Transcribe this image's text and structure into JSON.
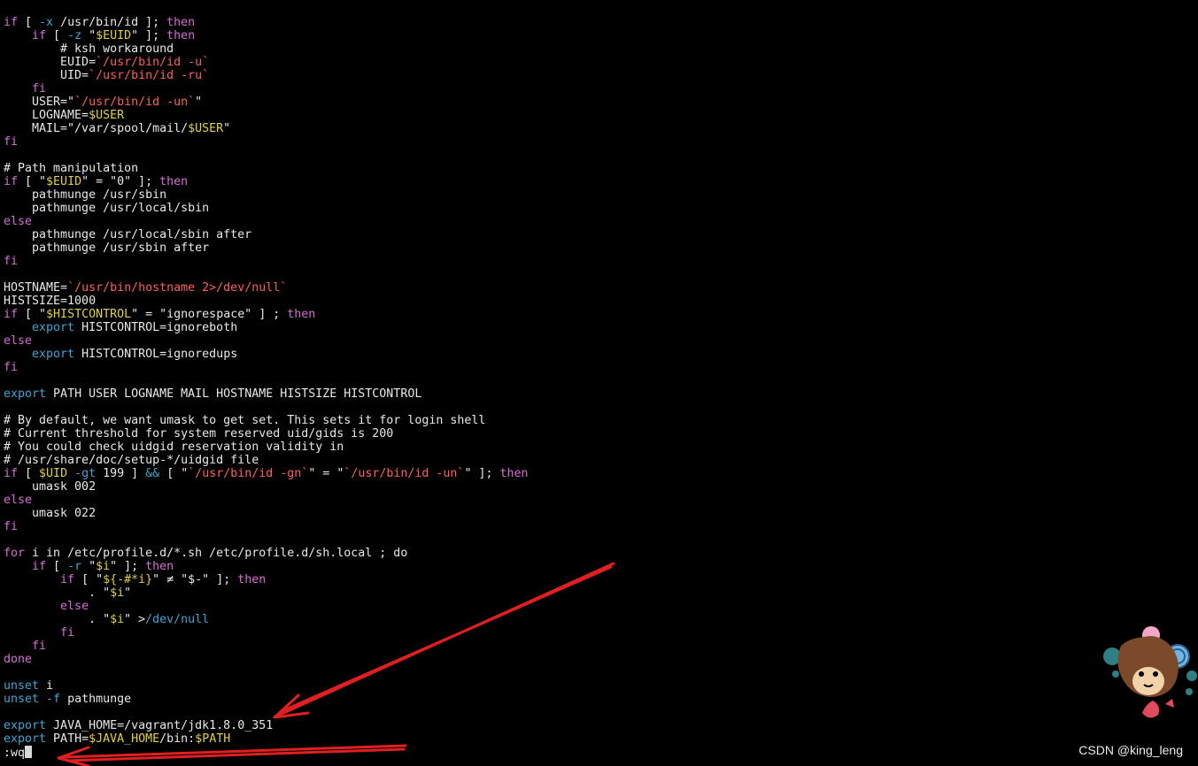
{
  "editor": {
    "command_line": ":wq",
    "lines": [
      [
        [
          "k",
          "if"
        ],
        [
          "d",
          " [ "
        ],
        [
          "o",
          "-x"
        ],
        [
          "d",
          " /usr/bin/id ]; "
        ],
        [
          "k",
          "then"
        ]
      ],
      [
        [
          "d",
          "    "
        ],
        [
          "k",
          "if"
        ],
        [
          "d",
          " [ "
        ],
        [
          "o",
          "-z"
        ],
        [
          "d",
          " \""
        ],
        [
          "v",
          "$EUID"
        ],
        [
          "d",
          "\" ]; "
        ],
        [
          "k",
          "then"
        ]
      ],
      [
        [
          "c",
          "        # ksh workaround"
        ]
      ],
      [
        [
          "d",
          "        EUID="
        ],
        [
          "s",
          "`/usr/bin/id -u`"
        ]
      ],
      [
        [
          "d",
          "        UID="
        ],
        [
          "s",
          "`/usr/bin/id -ru`"
        ]
      ],
      [
        [
          "d",
          "    "
        ],
        [
          "k",
          "fi"
        ]
      ],
      [
        [
          "d",
          "    USER=\""
        ],
        [
          "s",
          "`/usr/bin/id -un`"
        ],
        [
          "d",
          "\""
        ]
      ],
      [
        [
          "d",
          "    LOGNAME="
        ],
        [
          "v",
          "$USER"
        ]
      ],
      [
        [
          "d",
          "    MAIL=\"/var/spool/mail/"
        ],
        [
          "v",
          "$USER"
        ],
        [
          "d",
          "\""
        ]
      ],
      [
        [
          "k",
          "fi"
        ]
      ],
      [],
      [
        [
          "c",
          "# Path manipulation"
        ]
      ],
      [
        [
          "k",
          "if"
        ],
        [
          "d",
          " [ \""
        ],
        [
          "v",
          "$EUID"
        ],
        [
          "d",
          "\" = \"0\" ]; "
        ],
        [
          "k",
          "then"
        ]
      ],
      [
        [
          "d",
          "    pathmunge /usr/sbin"
        ]
      ],
      [
        [
          "d",
          "    pathmunge /usr/local/sbin"
        ]
      ],
      [
        [
          "k",
          "else"
        ]
      ],
      [
        [
          "d",
          "    pathmunge /usr/local/sbin after"
        ]
      ],
      [
        [
          "d",
          "    pathmunge /usr/sbin after"
        ]
      ],
      [
        [
          "k",
          "fi"
        ]
      ],
      [],
      [
        [
          "d",
          "HOSTNAME="
        ],
        [
          "s",
          "`/usr/bin/hostname 2>/dev/null`"
        ]
      ],
      [
        [
          "d",
          "HISTSIZE=1000"
        ]
      ],
      [
        [
          "k",
          "if"
        ],
        [
          "d",
          " [ \""
        ],
        [
          "v",
          "$HISTCONTROL"
        ],
        [
          "d",
          "\" = \"ignorespace\" ] ; "
        ],
        [
          "k",
          "then"
        ]
      ],
      [
        [
          "d",
          "    "
        ],
        [
          "kb",
          "export"
        ],
        [
          "d",
          " HISTCONTROL=ignoreboth"
        ]
      ],
      [
        [
          "k",
          "else"
        ]
      ],
      [
        [
          "d",
          "    "
        ],
        [
          "kb",
          "export"
        ],
        [
          "d",
          " HISTCONTROL=ignoredups"
        ]
      ],
      [
        [
          "k",
          "fi"
        ]
      ],
      [],
      [
        [
          "kb",
          "export"
        ],
        [
          "d",
          " PATH USER LOGNAME MAIL HOSTNAME HISTSIZE HISTCONTROL"
        ]
      ],
      [],
      [
        [
          "c",
          "# By default, we want umask to get set. This sets it for login shell"
        ]
      ],
      [
        [
          "c",
          "# Current threshold for system reserved uid/gids is 200"
        ]
      ],
      [
        [
          "c",
          "# You could check uidgid reservation validity in"
        ]
      ],
      [
        [
          "c",
          "# /usr/share/doc/setup-*/uidgid file"
        ]
      ],
      [
        [
          "k",
          "if"
        ],
        [
          "d",
          " [ "
        ],
        [
          "v",
          "$UID"
        ],
        [
          "d",
          " "
        ],
        [
          "o",
          "-gt"
        ],
        [
          "d",
          " 199 ] "
        ],
        [
          "o",
          "&&"
        ],
        [
          "d",
          " [ \""
        ],
        [
          "s",
          "`/usr/bin/id -gn`"
        ],
        [
          "d",
          "\" = \""
        ],
        [
          "s",
          "`/usr/bin/id -un`"
        ],
        [
          "d",
          "\" ]; "
        ],
        [
          "k",
          "then"
        ]
      ],
      [
        [
          "d",
          "    umask 002"
        ]
      ],
      [
        [
          "k",
          "else"
        ]
      ],
      [
        [
          "d",
          "    umask 022"
        ]
      ],
      [
        [
          "k",
          "fi"
        ]
      ],
      [],
      [
        [
          "k",
          "for"
        ],
        [
          "d",
          " i in /etc/profile.d/*.sh /etc/profile.d/sh.local ; do"
        ]
      ],
      [
        [
          "d",
          "    "
        ],
        [
          "k",
          "if"
        ],
        [
          "d",
          " [ "
        ],
        [
          "o",
          "-r"
        ],
        [
          "d",
          " \""
        ],
        [
          "v",
          "$i"
        ],
        [
          "d",
          "\" ]; "
        ],
        [
          "k",
          "then"
        ]
      ],
      [
        [
          "d",
          "        "
        ],
        [
          "k",
          "if"
        ],
        [
          "d",
          " [ \""
        ],
        [
          "v",
          "${-#*i}"
        ],
        [
          "d",
          "\" ≠ \"$-\" ]; "
        ],
        [
          "k",
          "then"
        ]
      ],
      [
        [
          "d",
          "            . \""
        ],
        [
          "v",
          "$i"
        ],
        [
          "d",
          "\""
        ]
      ],
      [
        [
          "d",
          "        "
        ],
        [
          "k",
          "else"
        ]
      ],
      [
        [
          "d",
          "            . \""
        ],
        [
          "v",
          "$i"
        ],
        [
          "d",
          "\" >"
        ],
        [
          "p",
          "/dev/null"
        ]
      ],
      [
        [
          "d",
          "        "
        ],
        [
          "k",
          "fi"
        ]
      ],
      [
        [
          "d",
          "    "
        ],
        [
          "k",
          "fi"
        ]
      ],
      [
        [
          "k",
          "done"
        ]
      ],
      [],
      [
        [
          "kb",
          "unset"
        ],
        [
          "d",
          " i"
        ]
      ],
      [
        [
          "kb",
          "unset"
        ],
        [
          "d",
          " "
        ],
        [
          "o",
          "-f"
        ],
        [
          "d",
          " pathmunge"
        ]
      ],
      [],
      [
        [
          "kb",
          "export"
        ],
        [
          "d",
          " JAVA_HOME=/vagrant/jdk1.8.0_351"
        ]
      ],
      [
        [
          "kb",
          "export"
        ],
        [
          "d",
          " PATH="
        ],
        [
          "v",
          "$JAVA_HOME"
        ],
        [
          "d",
          "/bin:"
        ],
        [
          "v",
          "$PATH"
        ]
      ]
    ]
  },
  "watermark": "CSDN @king_leng",
  "annotation_color": "#e02020",
  "mascot_icon": "cartoon-animal-sticker-icon"
}
